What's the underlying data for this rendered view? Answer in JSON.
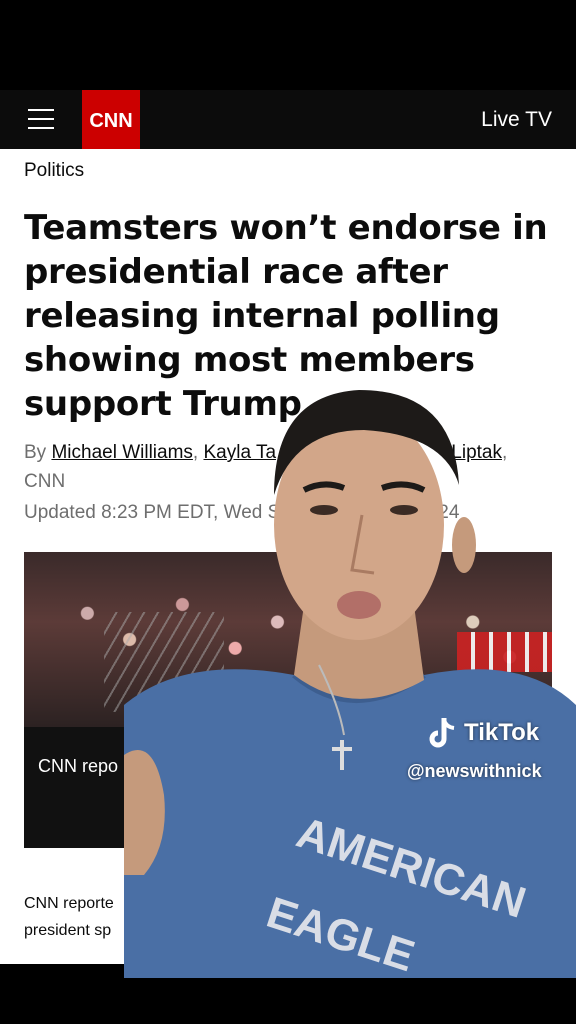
{
  "header": {
    "logo_text": "CNN",
    "live_tv_label": "Live TV"
  },
  "article": {
    "section": "Politics",
    "headline": "Teamsters won’t endorse in presidential race after releasing internal polling showing most members support Trump",
    "byline": {
      "prefix": "By ",
      "authors": [
        "Michael Williams",
        "Kayla Ta",
        "Liptak"
      ],
      "source": "CNN"
    },
    "updated": "Updated 8:23 PM EDT, Wed S",
    "updated_tail": "24",
    "photo_label": "CNN repo",
    "caption_lines": [
      "CNN reporte",
      "president sp"
    ]
  },
  "overlay": {
    "watermark_brand": "TikTok",
    "watermark_handle": "@newswithnick",
    "shirt_text_line1": "AMERICAN",
    "shirt_text_line2": "EAGLE"
  },
  "colors": {
    "cnn_red": "#cc0000",
    "shirt_blue": "#4a6fa5"
  }
}
